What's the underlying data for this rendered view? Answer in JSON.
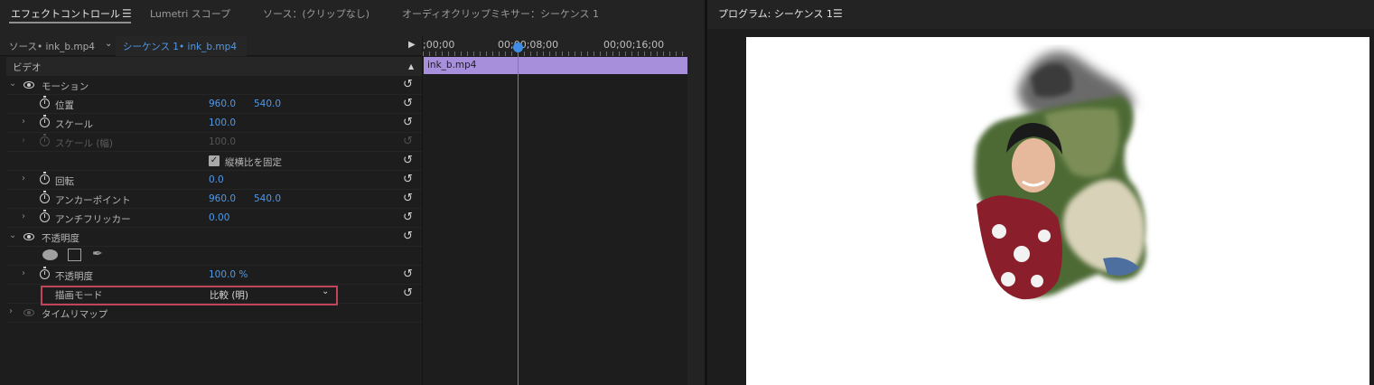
{
  "left_panel": {
    "tabs": [
      {
        "label": "エフェクトコントロール",
        "active": true
      },
      {
        "label": "Lumetri スコープ",
        "active": false
      },
      {
        "label": "ソース：(クリップなし)",
        "active": false
      },
      {
        "label": "オーディオクリップミキサー：シーケンス 1",
        "active": false
      }
    ],
    "menu_icon": "hamburger-icon",
    "source_label": "ソース• ink_b.mp4",
    "sequence_label": "シーケンス 1• ink_b.mp4",
    "section_video": "ビデオ",
    "effects": {
      "motion": {
        "label": "モーション",
        "position": {
          "label": "位置",
          "x": "960.0",
          "y": "540.0"
        },
        "scale": {
          "label": "スケール",
          "value": "100.0"
        },
        "scale_width": {
          "label": "スケール (幅)",
          "value": "100.0"
        },
        "uniform_scale": {
          "label": "縦横比を固定",
          "checked": true
        },
        "rotation": {
          "label": "回転",
          "value": "0.0"
        },
        "anchor_point": {
          "label": "アンカーポイント",
          "x": "960.0",
          "y": "540.0"
        },
        "anti_flicker": {
          "label": "アンチフリッカー",
          "value": "0.00"
        }
      },
      "opacity": {
        "label": "不透明度",
        "opacity_param": {
          "label": "不透明度",
          "value": "100.0 %"
        },
        "blend_mode": {
          "label": "描画モード",
          "value": "比較 (明)"
        }
      },
      "time_remap": {
        "label": "タイムリマップ"
      }
    },
    "timeline": {
      "ticks": [
        ";00;00",
        "00;00;08;00",
        "00;00;16;00"
      ],
      "clip_name": "ink_b.mp4"
    }
  },
  "right_panel": {
    "title": "プログラム: シーケンス 1",
    "menu_icon": "hamburger-icon"
  },
  "colors": {
    "accent_blue": "#4f9ae8",
    "clip_purple": "#a88fdc",
    "highlight_red": "#c2445a",
    "playhead": "#3f8de6"
  }
}
